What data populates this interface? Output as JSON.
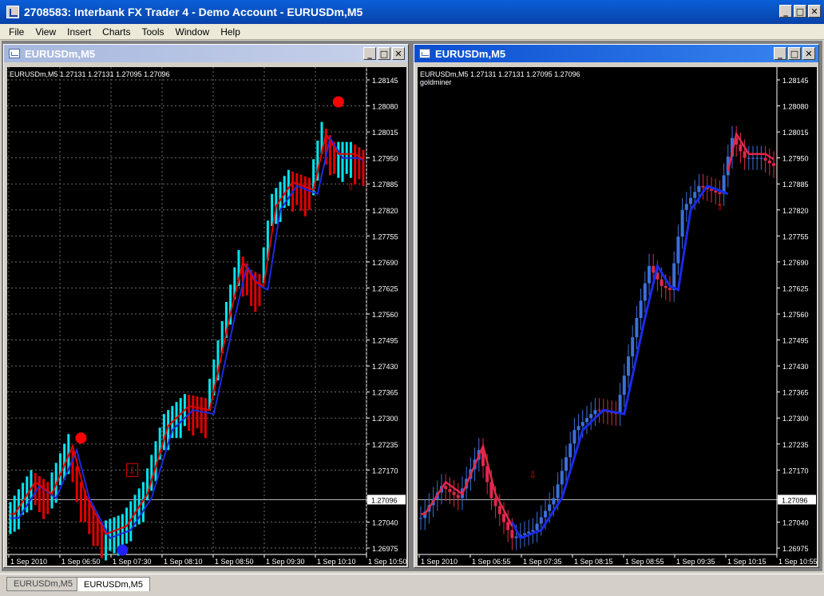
{
  "app": {
    "title": "2708583: Interbank FX Trader 4 - Demo Account - EURUSDm,M5"
  },
  "window_buttons": {
    "minimize": "_",
    "maximize": "□",
    "close": "✕"
  },
  "menu": [
    "File",
    "View",
    "Insert",
    "Charts",
    "Tools",
    "Window",
    "Help"
  ],
  "charts": [
    {
      "title": "EURUSDm,M5",
      "info": "EURUSDm,M5  1.27131 1.27131 1.27095 1.27096",
      "indicator": "",
      "price_labels": [
        "1.28145",
        "1.28080",
        "1.28015",
        "1.27950",
        "1.27885",
        "1.27820",
        "1.27755",
        "1.27690",
        "1.27625",
        "1.27560",
        "1.27495",
        "1.27430",
        "1.27365",
        "1.27300",
        "1.27235",
        "1.27170",
        "1.27096",
        "1.27040",
        "1.26975"
      ],
      "current_price": "1.27096",
      "time_labels": [
        "1 Sep 2010",
        "1 Sep 06:50",
        "1 Sep 07:30",
        "1 Sep 08:10",
        "1 Sep 08:50",
        "1 Sep 09:30",
        "1 Sep 10:10",
        "1 Sep 10:50"
      ]
    },
    {
      "title": "EURUSDm,M5",
      "info": "EURUSDm,M5  1.27131 1.27131 1.27095 1.27096",
      "indicator": "goldminer",
      "price_labels": [
        "1.28145",
        "1.28080",
        "1.28015",
        "1.27950",
        "1.27885",
        "1.27820",
        "1.27755",
        "1.27690",
        "1.27625",
        "1.27560",
        "1.27495",
        "1.27430",
        "1.27365",
        "1.27300",
        "1.27235",
        "1.27170",
        "1.27096",
        "1.27040",
        "1.26975"
      ],
      "current_price": "1.27096",
      "time_labels": [
        "1 Sep 2010",
        "1 Sep 06:55",
        "1 Sep 07:35",
        "1 Sep 08:15",
        "1 Sep 08:55",
        "1 Sep 09:35",
        "1 Sep 10:15",
        "1 Sep 10:55"
      ]
    }
  ],
  "tabs": [
    "EURUSDm,M5",
    "EURUSDm,M5"
  ],
  "colors": {
    "bull_left": "#00e5ee",
    "bear_left": "#e00000",
    "bull_right": "#3c6fd8",
    "bear_right": "#e0284a",
    "ma_blue": "#1a2be0",
    "ma_red": "#e00000"
  }
}
